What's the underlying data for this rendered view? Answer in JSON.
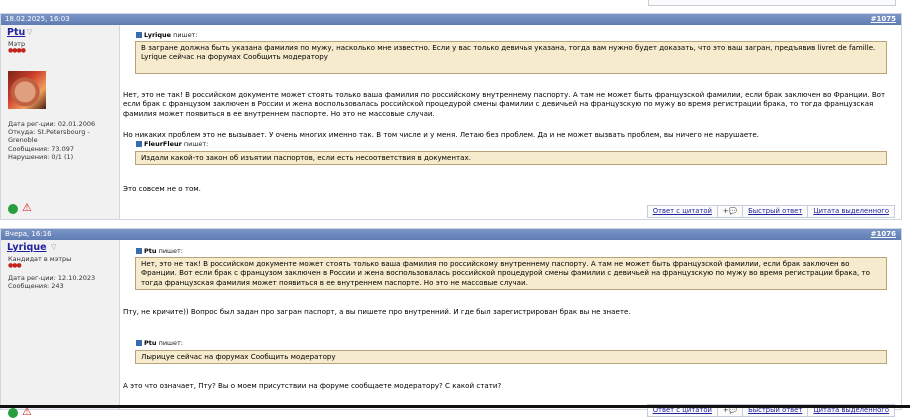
{
  "posts": [
    {
      "date": "18.02.2025, 16:03",
      "number": "#1075",
      "username": "Ptu",
      "user_title": "Мэтр",
      "stars": "●●●●",
      "user_info": "Дата рег-ции: 02.01.2006\nОткуда: St.Petersbourg - Grenoble\nСообщения: 73.097\nНарушения: 0/1 (1)",
      "quote1_author": "Lyrique",
      "quote1_says": "пишет:",
      "quote1_text": "В загране должна быть указана фамилия по мужу, насколько мне известно. Если у вас только девичья указана, тогда вам нужно будет доказать, что это ваш загран, предъявив livret de famille.\nLyrique сейчас на форумах Сообщить модератору",
      "para1": "Нет, это не так! В российском документе может стоять только ваша фамилия по российскому внутреннему паспорту. А там не может быть французской фамилии, если брак заключен во Франции. Вот если брак с французом заключен в России и жена воспользовалась российской процедурой смены фамилии с девичьей на французскую по мужу во время регистрации брака, то тогда французская фамилия может появиться в ее внутреннем паспорте. Но это не массовые случаи.",
      "para2": "Но никаких проблем это не вызывает. У очень многих именно так. В том числе и у меня. Летаю без проблем. Да и не может вызвать проблем, вы ничего не нарушаете.",
      "quote2_author": "FleurFleur",
      "quote2_says": "пишет:",
      "quote2_text": "Издали какой-то закон об изъятии паспортов, если есть несоответствия в документах.",
      "para3": "Это совсем не о том.",
      "reply_quote": "Ответ с цитатой",
      "plus": "+",
      "quick_reply": "Быстрый ответ",
      "quote_selected": "Цитата выделенного"
    },
    {
      "date": "Вчера, 16:16",
      "number": "#1076",
      "username": "Lyrique",
      "user_title": "Кандидат в мэтры",
      "stars": "●●●",
      "user_info": "Дата рег-ции: 12.10.2023\nСообщения: 243",
      "quote1_author": "Ptu",
      "quote1_says": "пишет:",
      "quote1_text": "Нет, это не так! В российском документе может стоять только ваша фамилия по российскому внутреннему паспорту. А там не может быть французской фамилии, если брак заключен во Франции. Вот если брак с французом заключен в России и жена воспользовалась российской процедурой смены фамилии с девичьей на французскую по мужу во время регистрации брака, то тогда французская фамилия может появиться в ее внутреннем паспорте. Но это не массовые случаи.",
      "para1": "Пту, не кричите)) Вопрос был задан про загран паспорт, а вы пишете про внутренний. И где был зарегистрирован брак вы не знаете.",
      "quote2_author": "Ptu",
      "quote2_says": "пишет:",
      "quote2_text": "Лырицуе сейчас на форумах Сообщить модератору",
      "para2": "А это что означает, Пту? Вы о моем присутствии на форуме сообщаете модератору? С какой стати?",
      "reply_quote": "Ответ с цитатой",
      "plus": "+",
      "quick_reply": "Быстрый ответ",
      "quote_selected": "Цитата выделенного"
    }
  ]
}
